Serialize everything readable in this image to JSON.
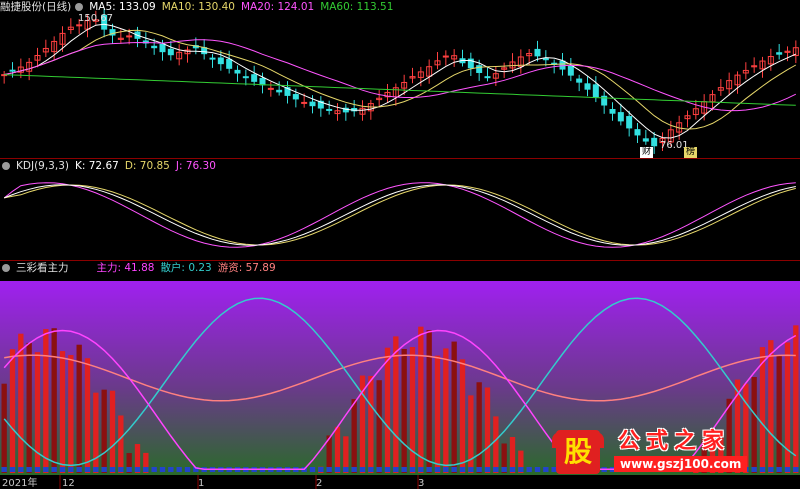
{
  "price_panel": {
    "stock_name": "融捷股份(日线)",
    "ma5": "MA5: 133.09",
    "ma10": "MA10: 130.40",
    "ma20": "MA20: 124.01",
    "ma60": "MA60: 113.51",
    "high_label": "150.67",
    "low_label": "76.01",
    "badge1": "财",
    "badge2": "榜",
    "colors": {
      "ma5": "#ffffff",
      "ma10": "#e6d76a",
      "ma20": "#ff55ff",
      "ma60": "#33cc33",
      "up": "#ff4040",
      "down": "#33e0e0"
    }
  },
  "kdj_panel": {
    "name": "KDJ(9,3,3)",
    "k": "K: 72.67",
    "d": "D: 70.85",
    "j": "J: 76.30",
    "colors": {
      "k": "#ffffff",
      "d": "#e6d76a",
      "j": "#ff55ff"
    }
  },
  "main_force_panel": {
    "name": "三彩看主力",
    "zhuli": "主力: 41.88",
    "sanhu": "散户: 0.23",
    "youzi": "游资: 57.89",
    "colors": {
      "zhuli": "#ff44ff",
      "sanhu": "#33cccc",
      "youzi": "#ff8080"
    }
  },
  "x_axis": {
    "labels": [
      "2021年",
      "12",
      "1",
      "2",
      "3"
    ]
  },
  "watermark": {
    "char": "股",
    "text": "公式之家",
    "url": "www.gszj100.com"
  },
  "chart_data": {
    "type": "line",
    "title": "融捷股份(日线)",
    "price": {
      "high": 150.67,
      "low": 76.01,
      "ma60_range": [
        101,
        118
      ],
      "series_close": [
        118,
        121,
        125,
        131,
        137,
        144,
        146,
        150,
        142,
        138,
        140,
        136,
        132,
        129,
        131,
        133,
        128,
        124,
        120,
        116,
        113,
        110,
        107,
        104,
        101,
        99,
        98,
        97,
        99,
        103,
        108,
        112,
        117,
        121,
        126,
        130,
        124,
        120,
        116,
        121,
        126,
        130,
        128,
        124,
        120,
        114,
        108,
        101,
        94,
        88,
        82,
        78,
        86,
        92,
        98,
        104,
        110,
        116,
        120,
        124,
        128,
        130,
        133
      ]
    },
    "kdj": {
      "K": 72.67,
      "D": 70.85,
      "J": 76.3
    },
    "main_force": {
      "zhuli": 41.88,
      "sanhu": 0.23,
      "youzi": 57.89
    }
  }
}
